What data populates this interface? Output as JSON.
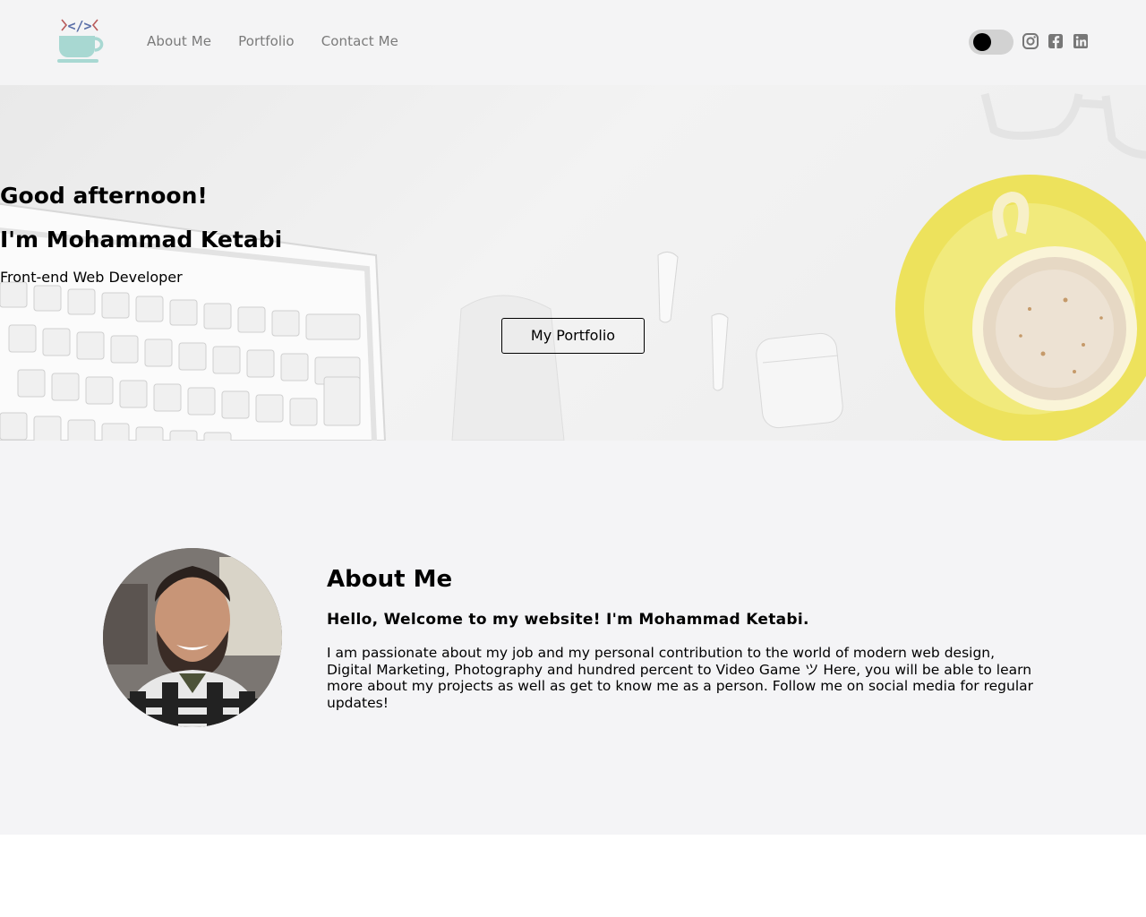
{
  "nav": {
    "items": [
      {
        "label": "About Me"
      },
      {
        "label": "Portfolio"
      },
      {
        "label": "Contact Me"
      }
    ]
  },
  "social": {
    "icons": [
      "instagram-icon",
      "facebook-icon",
      "linkedin-icon"
    ]
  },
  "theme_toggle": {
    "state": "off"
  },
  "hero": {
    "greeting": "Good afternoon!",
    "name": "I'm Mohammad Ketabi",
    "role": "Front-end Web Developer",
    "button_label": "My Portfolio"
  },
  "about": {
    "title": "About Me",
    "subtitle": "Hello, Welcome to my website! I'm Mohammad Ketabi.",
    "body": "I am passionate about my job and my personal contribution to the world of modern web design, Digital Marketing, Photography and hundred percent to Video Game ツ Here, you will be able to learn more about my projects as well as get to know me as a person. Follow me on social media for regular updates!"
  },
  "colors": {
    "header_bg": "#f4f4f5",
    "about_bg": "#f4f4f6",
    "nav_text": "#7a7a7a",
    "logo_cup": "#a8d8d2",
    "saucer_yellow": "#ede25c"
  }
}
